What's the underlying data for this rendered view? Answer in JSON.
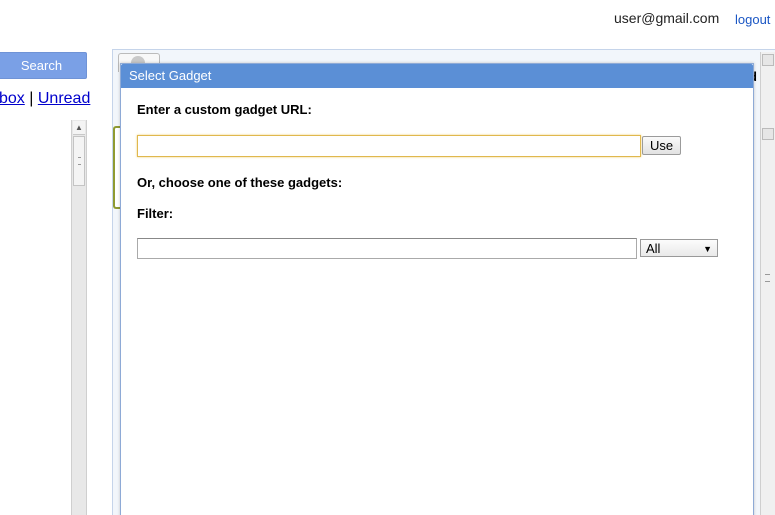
{
  "header": {
    "user_email": "user@gmail.com",
    "logout_label": "logout"
  },
  "sidebar": {
    "search_button_label": "Search",
    "folder_links": [
      {
        "label": "box"
      },
      {
        "label": "Unread"
      }
    ],
    "separator": "|"
  },
  "panel": {
    "peek_text": "d"
  },
  "dialog": {
    "title": "Select Gadget",
    "custom_url_label": "Enter a custom gadget URL:",
    "custom_url_value": "",
    "use_button_label": "Use",
    "choose_label": "Or, choose one of these gadgets:",
    "filter_label": "Filter:",
    "filter_value": "",
    "filter_select": {
      "selected": "All"
    }
  },
  "colors": {
    "dialog_title_bg": "#5b8fd6",
    "search_button_bg": "#7aa0e6",
    "link": "#0000cc",
    "focused_input_border": "#e0b84e"
  }
}
